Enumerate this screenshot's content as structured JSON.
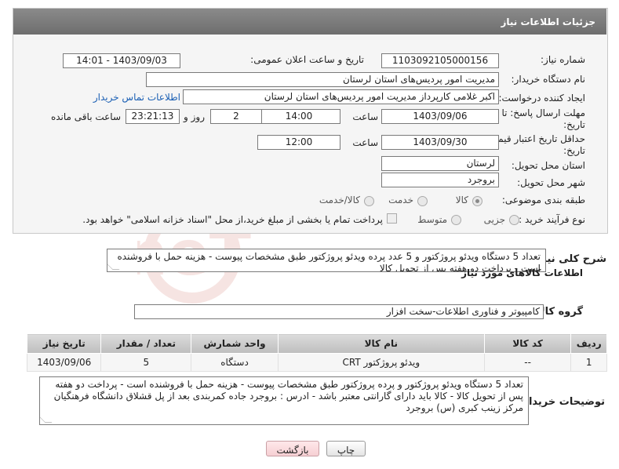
{
  "header": {
    "title": "جزئیات اطلاعات نیاز"
  },
  "fields": {
    "need_number_label": "شماره نیاز:",
    "need_number": "1103092105000156",
    "announce_label": "تاریخ و ساعت اعلان عمومی:",
    "announce_value": "1403/09/03 - 14:01",
    "buyer_org_label": "نام دستگاه خریدار:",
    "buyer_org": "مدیریت امور پردیس‌های استان لرستان",
    "creator_label": "ایجاد کننده درخواست:",
    "creator": "اکبر غلامی کارپرداز مدیریت امور پردیس‌های استان لرستان",
    "contact_link": "اطلاعات تماس خریدار",
    "deadline_label": "مهلت ارسال پاسخ: تا تاریخ:",
    "deadline_date": "1403/09/06",
    "time_label": "ساعت",
    "deadline_time": "14:00",
    "days_value": "2",
    "days_label": "روز و",
    "remaining_time": "23:21:13",
    "remaining_label": "ساعت باقی مانده",
    "validity_label": "حداقل تاریخ اعتبار قیمت: تا تاریخ:",
    "validity_date": "1403/09/30",
    "validity_time": "12:00",
    "province_label": "استان محل تحویل:",
    "province": "لرستان",
    "city_label": "شهر محل تحویل:",
    "city": "بروجرد",
    "category_label": "طبقه بندی موضوعی:",
    "category_options": [
      "کالا",
      "خدمت",
      "کالا/خدمت"
    ],
    "process_label": "نوع فرآیند خرید :",
    "process_options": [
      "جزیی",
      "متوسط"
    ],
    "payment_note": "پرداخت تمام یا بخشی از مبلغ خرید،از محل \"اسناد خزانه اسلامی\" خواهد بود."
  },
  "description": {
    "label": "شرح کلی نیاز:",
    "text": "تعداد 5 دستگاه ویدئو پروژکتور و 5 عدد پرده ویدئو پروژکتور طبق مشخصات پیوست - هزینه حمل با فروشنده است - پرداخت دو هفته پس از تحویل کالا"
  },
  "goods": {
    "section_title": "اطلاعات کالاهای مورد نیاز",
    "group_label": "گروه کالا:",
    "group_value": "کامپیوتر و فناوری اطلاعات-سخت افزار",
    "columns": [
      "ردیف",
      "کد کالا",
      "نام کالا",
      "واحد شمارش",
      "تعداد / مقدار",
      "تاریخ نیاز"
    ],
    "rows": [
      [
        "1",
        "--",
        "ویدئو پروژکتور CRT",
        "دستگاه",
        "5",
        "1403/09/06"
      ]
    ]
  },
  "buyer_notes": {
    "label": "توضیحات خریدار:",
    "text": "تعداد 5 دستگاه ویدئو پروژکتور و پرده پروژکتور طبق مشخصات پیوست - هزینه حمل با فروشنده است - پرداخت دو هفته پس از تحویل کالا - کالا باید دارای گارانتی معتبر باشد - ادرس : بروجرد جاده کمربندی بعد از پل قشلاق دانشگاه فرهنگیان مرکز زینب کبری (س) بروجرد"
  },
  "buttons": {
    "print": "چاپ",
    "back": "بازگشت"
  },
  "watermark_text": "AriaTender.neT"
}
